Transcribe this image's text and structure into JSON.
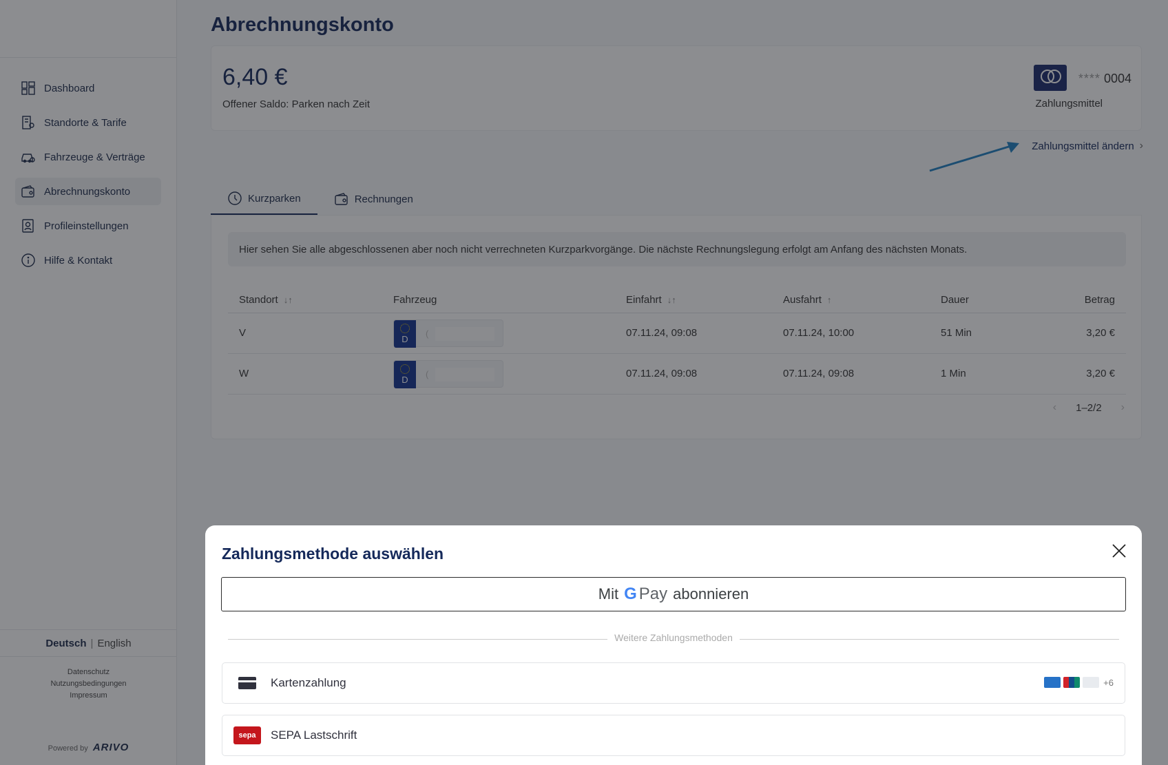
{
  "sidebar": {
    "items": [
      {
        "label": "Dashboard",
        "icon": "dashboard-icon"
      },
      {
        "label": "Standorte & Tarife",
        "icon": "location-icon"
      },
      {
        "label": "Fahrzeuge & Verträge",
        "icon": "car-icon"
      },
      {
        "label": "Abrechnungskonto",
        "icon": "wallet-icon",
        "active": true
      },
      {
        "label": "Profileinstellungen",
        "icon": "profile-icon"
      },
      {
        "label": "Hilfe & Kontakt",
        "icon": "info-icon"
      }
    ],
    "lang_active": "Deutsch",
    "lang_sep": "|",
    "lang_other": "English",
    "links": [
      "Datenschutz",
      "Nutzungsbedingungen",
      "Impressum"
    ],
    "powered_by": "Powered by",
    "brand": "ARIVO"
  },
  "page": {
    "title": "Abrechnungskonto",
    "balance": "6,40 €",
    "balance_label": "Offener Saldo: Parken nach Zeit",
    "card_stars": "****",
    "card_last4": "0004",
    "payment_label": "Zahlungsmittel",
    "change_payment": "Zahlungsmittel ändern",
    "tabs": [
      {
        "label": "Kurzparken",
        "icon": "clock-icon",
        "active": true
      },
      {
        "label": "Rechnungen",
        "icon": "wallet-icon"
      }
    ],
    "info_text": "Hier sehen Sie alle abgeschlossenen aber noch nicht verrechneten Kurzparkvorgänge. Die nächste Rechnungslegung erfolgt am Anfang des nächsten Monats.",
    "columns": [
      "Standort",
      "Fahrzeug",
      "Einfahrt",
      "Ausfahrt",
      "Dauer",
      "Betrag"
    ],
    "rows": [
      {
        "standort": "V",
        "country": "D",
        "plate": "(",
        "einfahrt": "07.11.24, 09:08",
        "ausfahrt": "07.11.24, 10:00",
        "dauer": "51 Min",
        "betrag": "3,20 €"
      },
      {
        "standort": "W",
        "country": "D",
        "plate": "(",
        "einfahrt": "07.11.24, 09:08",
        "ausfahrt": "07.11.24, 09:08",
        "dauer": "1 Min",
        "betrag": "3,20 €"
      }
    ],
    "pagination": "1–2/2"
  },
  "modal": {
    "title": "Zahlungsmethode auswählen",
    "gpay_prefix": "Mit",
    "gpay_g": "G",
    "gpay_pay": "Pay",
    "gpay_suffix": "abonnieren",
    "divider_label": "Weitere Zahlungsmethoden",
    "methods": [
      {
        "label": "Kartenzahlung",
        "icon": "credit-card-icon",
        "more": "+6"
      },
      {
        "label": "SEPA Lastschrift",
        "icon": "sepa-icon",
        "logo_text": "sepa"
      }
    ]
  },
  "colors": {
    "primary": "#15295a",
    "annotation_arrow": "#1e7fc0",
    "sepa": "#c4161c",
    "overlay": "rgba(25,28,33,0.5)"
  }
}
